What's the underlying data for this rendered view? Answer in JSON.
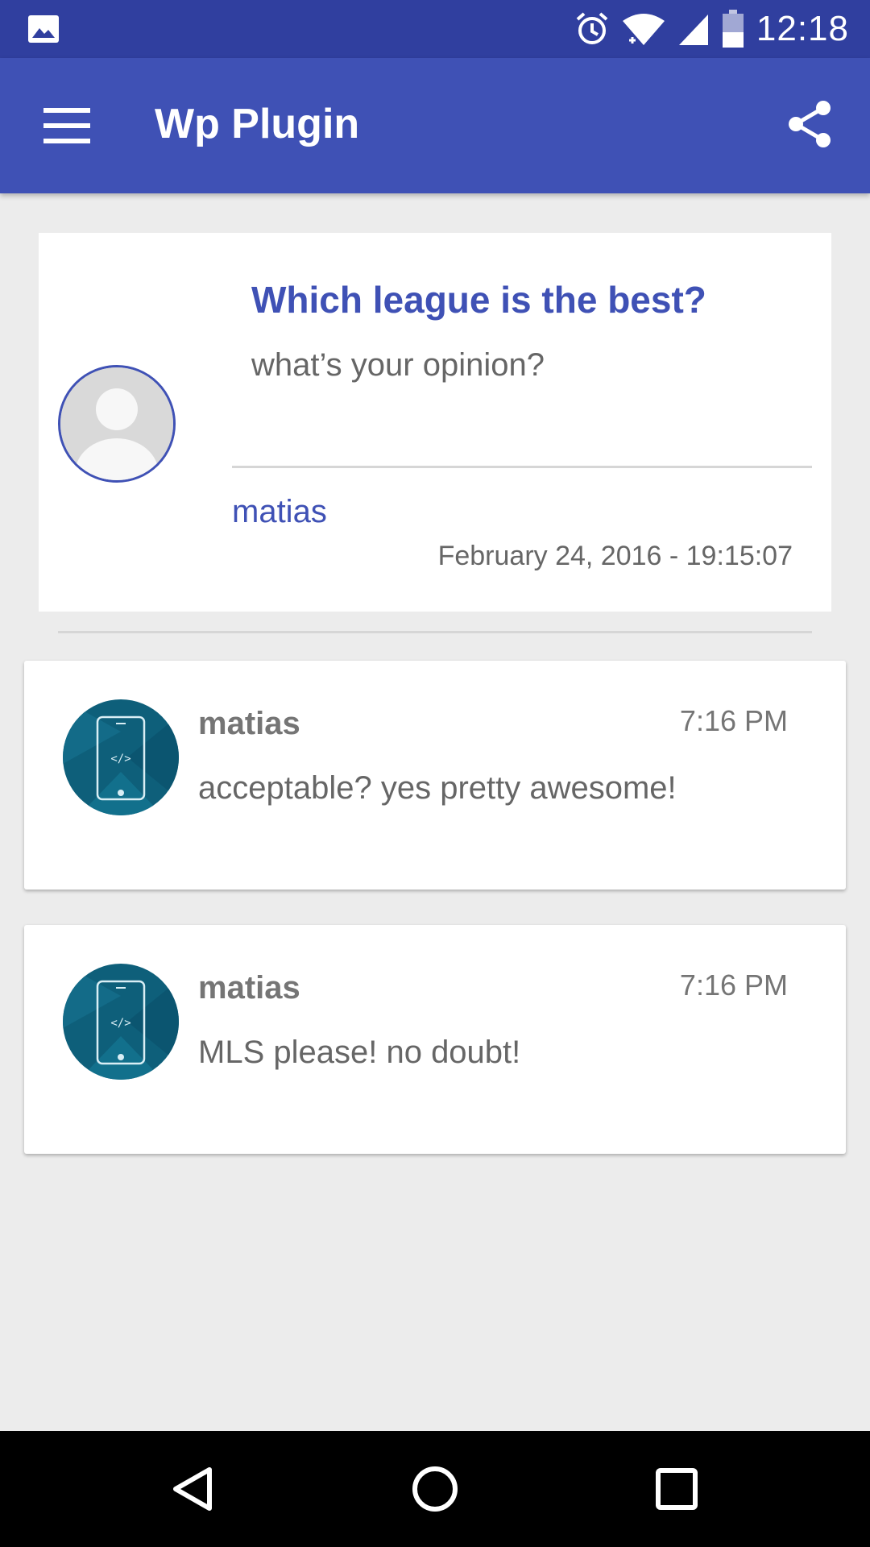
{
  "status_bar": {
    "time": "12:18",
    "icons": [
      "image-icon",
      "alarm-icon",
      "wifi-icon",
      "signal-icon",
      "battery-icon"
    ]
  },
  "app_bar": {
    "title": "Wp Plugin",
    "icons": [
      "menu-icon",
      "share-icon"
    ]
  },
  "question": {
    "title": "Which league is the best?",
    "subtitle": "what’s your opinion?",
    "author": "matias",
    "date": "February 24, 2016 - 19:15:07"
  },
  "comments": [
    {
      "author": "matias",
      "time": "7:16 PM",
      "text": "acceptable? yes pretty awesome!"
    },
    {
      "author": "matias",
      "time": "7:16 PM",
      "text": "MLS please! no doubt!"
    }
  ],
  "nav_bar": {
    "icons": [
      "back-icon",
      "home-icon",
      "recents-icon"
    ]
  },
  "colors": {
    "status_bar": "#303f9f",
    "app_bar": "#3f51b5",
    "accent": "#3f51b5",
    "background": "#ececec",
    "avatar_teal": "#0e5f7a"
  }
}
